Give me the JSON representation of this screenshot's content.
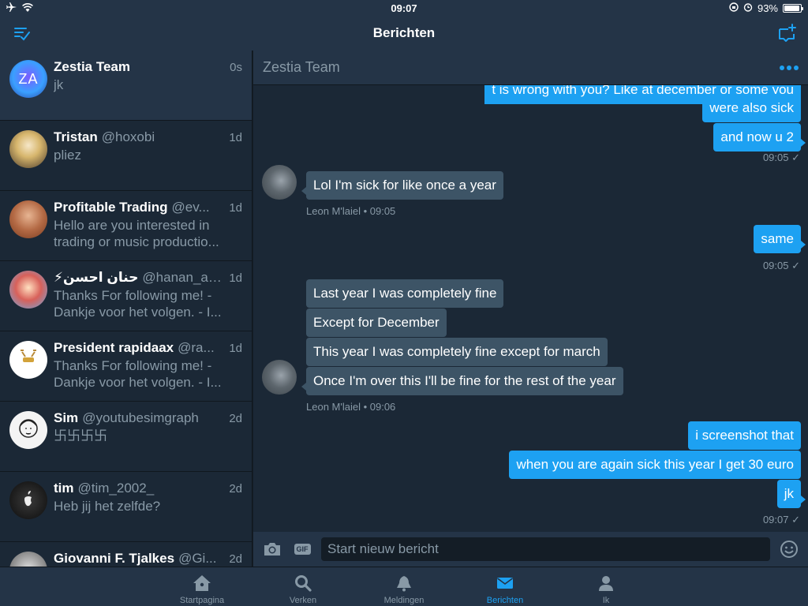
{
  "statusbar": {
    "time": "09:07",
    "battery": "93%",
    "battery_level": 0.93
  },
  "navbar": {
    "title": "Berichten"
  },
  "conversations": [
    {
      "name": "Zestia Team",
      "handle": "",
      "time": "0s",
      "preview": "jk",
      "active": true,
      "avatar_text": "ZA"
    },
    {
      "name": "Tristan",
      "handle": "@hoxobi",
      "time": "1d",
      "preview": "pliez"
    },
    {
      "name": "Profitable Trading",
      "handle": "@ev...",
      "time": "1d",
      "preview": "Hello are you interested in trading or music productio..."
    },
    {
      "name": "⚡حنان احسن",
      "handle": "@hanan_ah...",
      "time": "1d",
      "preview": "Thanks For following me! - Dankje voor het volgen. - I..."
    },
    {
      "name": "President rapidaax",
      "handle": "@ra...",
      "time": "1d",
      "preview": "Thanks For following me! - Dankje voor het volgen. - I..."
    },
    {
      "name": "Sim",
      "handle": "@youtubesimgraph",
      "time": "2d",
      "preview": "卐卐卐卐"
    },
    {
      "name": "tim",
      "handle": "@tim_2002_",
      "time": "2d",
      "preview": "Heb jij het zelfde?"
    },
    {
      "name": "Giovanni F. Tjalkes",
      "handle": "@Gi...",
      "time": "2d",
      "preview": ""
    }
  ],
  "chat": {
    "title": "Zestia Team",
    "messages": [
      {
        "dir": "out",
        "text": "t is wrong with you?  Like at december or some you"
      },
      {
        "dir": "out",
        "text": "were also sick"
      },
      {
        "dir": "out",
        "text": "and now u 2"
      },
      {
        "meta": "09:05 ✓"
      },
      {
        "dir": "in",
        "text": "Lol I'm sick for like once a year"
      },
      {
        "meta": "Leon M'laiel • 09:05"
      },
      {
        "dir": "out",
        "text": "same"
      },
      {
        "meta": "09:05 ✓"
      },
      {
        "dir": "in",
        "text": "Last year I was completely fine"
      },
      {
        "dir": "in",
        "text": "Except for December"
      },
      {
        "dir": "in",
        "text": "This year I was completely fine except for march"
      },
      {
        "dir": "in",
        "text": "Once I'm over this I'll be fine for the rest of the year"
      },
      {
        "meta": "Leon M'laiel • 09:06"
      },
      {
        "dir": "out",
        "text": "i screenshot that"
      },
      {
        "dir": "out",
        "text": "when you are again sick this year I get 30 euro"
      },
      {
        "dir": "out",
        "text": "jk"
      },
      {
        "meta": "09:07 ✓"
      }
    ],
    "composer_placeholder": "Start nieuw bericht",
    "gif_label": "GIF"
  },
  "tabs": [
    {
      "label": "Startpagina",
      "icon": "home-icon"
    },
    {
      "label": "Verken",
      "icon": "search-icon"
    },
    {
      "label": "Meldingen",
      "icon": "bell-icon"
    },
    {
      "label": "Berichten",
      "icon": "mail-icon",
      "active": true
    },
    {
      "label": "Ik",
      "icon": "person-icon"
    }
  ],
  "colors": {
    "accent": "#1da1f2",
    "background": "#1b2836",
    "bar": "#243447",
    "incoming_bubble": "#3d5466",
    "muted": "#8899a6"
  }
}
